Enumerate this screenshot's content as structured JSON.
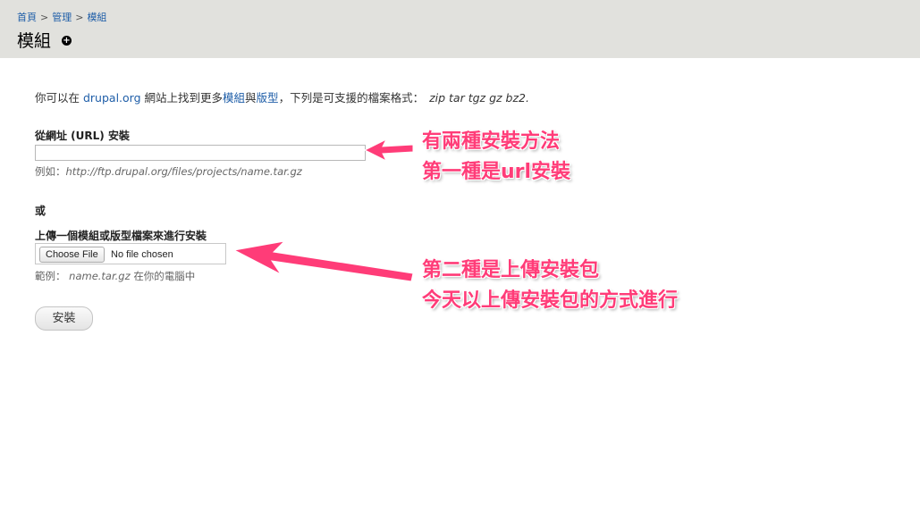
{
  "breadcrumb": {
    "items": [
      "首頁",
      "管理",
      "模組"
    ],
    "separator": ">"
  },
  "page": {
    "title": "模組",
    "add_icon": "plus-circle-icon"
  },
  "intro": {
    "prefix": "你可以在 ",
    "site_link": "drupal.org",
    "middle": " 網站上找到更多",
    "modules_link": "模組",
    "conj": "與",
    "themes_link": "版型",
    "suffix": "，下列是可支援的檔案格式：",
    "formats": "zip tar tgz gz bz2."
  },
  "url_install": {
    "label": "從網址 (URL) 安裝",
    "value": "",
    "description_prefix": "例如：",
    "description_example": "http://ftp.drupal.org/files/projects/name.tar.gz"
  },
  "or_text": "或",
  "upload_install": {
    "label": "上傳一個模組或版型檔案來進行安裝",
    "choose_button": "Choose File",
    "file_status": "No file chosen",
    "description_prefix": "範例：",
    "description_example": "name.tar.gz",
    "description_suffix": "在你的電腦中"
  },
  "submit": {
    "label": "安裝"
  },
  "annotations": {
    "line1": "有兩種安裝方法",
    "line2": "第一種是url安裝",
    "line3": "第二種是上傳安裝包",
    "line4": "今天以上傳安裝包的方式進行",
    "color": "#ff3c78"
  },
  "colors": {
    "header_bg": "#e1e1dd",
    "link": "#1f5ea8"
  }
}
